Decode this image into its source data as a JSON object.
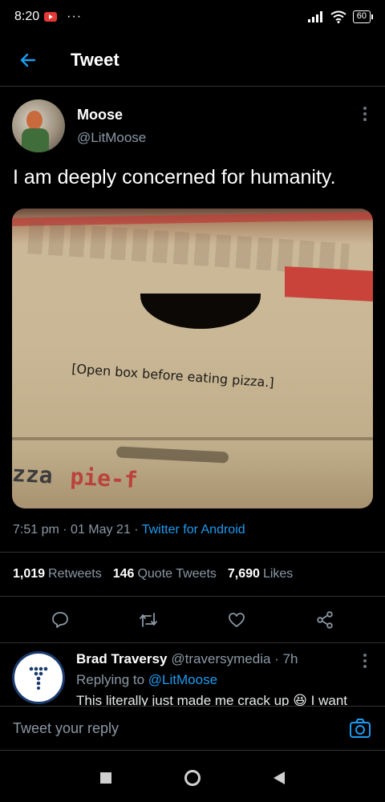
{
  "status_bar": {
    "time": "8:20",
    "dots": "···",
    "battery": "60"
  },
  "header": {
    "title": "Tweet"
  },
  "tweet": {
    "author_name": "Moose",
    "author_handle": "@LitMoose",
    "text": "I am deeply concerned for humanity.",
    "photo": {
      "caption": "[Open box before eating pizza.]",
      "bottom_print_left": "zza",
      "bottom_print_right": "pie-f"
    },
    "meta": {
      "time": "7:51 pm",
      "date": "01 May 21",
      "separator": "·",
      "source": "Twitter for Android"
    },
    "stats": {
      "retweets_count": "1,019",
      "retweets_label": "Retweets",
      "quote_count": "146",
      "quote_label": "Quote Tweets",
      "likes_count": "7,690",
      "likes_label": "Likes"
    }
  },
  "reply": {
    "name": "Brad Traversy",
    "handle": "@traversymedia",
    "age": "· 7h",
    "replying_prefix": "Replying to",
    "replying_to": "@LitMoose",
    "text": "This literally just made me crack up 😆 I want"
  },
  "composer": {
    "placeholder": "Tweet your reply"
  },
  "colors": {
    "accent": "#1d9bf0",
    "background": "#000000",
    "muted": "#8b98a5"
  }
}
